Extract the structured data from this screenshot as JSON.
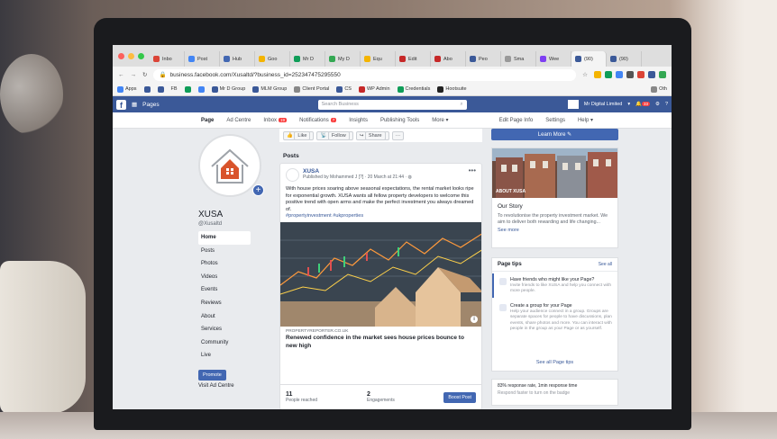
{
  "browser": {
    "tabs": [
      {
        "label": "Inbo",
        "color": "#db4437"
      },
      {
        "label": "Post",
        "color": "#4285f4"
      },
      {
        "label": "Hub",
        "color": "#4267b2"
      },
      {
        "label": "Goo",
        "color": "#f4b400"
      },
      {
        "label": "Mr D",
        "color": "#0f9d58"
      },
      {
        "label": "My D",
        "color": "#34a853"
      },
      {
        "label": "Equ",
        "color": "#f4b400"
      },
      {
        "label": "Edit",
        "color": "#c62828"
      },
      {
        "label": "Abo",
        "color": "#c62828"
      },
      {
        "label": "Peo",
        "color": "#3b5998"
      },
      {
        "label": "Sma",
        "color": "#999999"
      },
      {
        "label": "Wee",
        "color": "#7e3ff2"
      },
      {
        "label": "(90)",
        "color": "#3b5998"
      },
      {
        "label": "(90)",
        "color": "#3b5998"
      }
    ],
    "url": "business.facebook.com/Xusaltd/?business_id=252347475295550",
    "bookmarks": [
      "Apps",
      "FB",
      "Mr D Group",
      "MLM Group",
      "Client Portal",
      "CS",
      "WP Admin",
      "Credentials",
      "Hootsuite",
      "Oth"
    ]
  },
  "fb": {
    "logo": "f",
    "pages_label": "Pages",
    "search_placeholder": "Search Business",
    "account": "Mr Digital Limited",
    "notif_count": "33",
    "nav": {
      "page": "Page",
      "ad_centre": "Ad Centre",
      "inbox": "Inbox",
      "inbox_count": "19",
      "notifications": "Notifications",
      "notifications_count": "7",
      "insights": "Insights",
      "publishing_tools": "Publishing Tools",
      "more": "More",
      "edit_page_info": "Edit Page Info",
      "settings": "Settings",
      "help": "Help"
    },
    "profile": {
      "name": "XUSA",
      "handle": "@Xusaltd"
    },
    "left_nav": [
      "Home",
      "Posts",
      "Photos",
      "Videos",
      "Events",
      "Reviews",
      "About",
      "Services",
      "Community",
      "Live"
    ],
    "promote": "Promote",
    "visit_ad_centre": "Visit Ad Centre",
    "actions": {
      "like": "Like",
      "follow": "Follow",
      "share": "Share",
      "more": "···"
    },
    "posts_label": "Posts",
    "post": {
      "author": "XUSA",
      "meta": "Published by Mohammed J [?] · 20 March at 21:44 · ",
      "text": "With house prices soaring above seasonal expectations, the rental market looks ripe for exponential growth. XUSA wants all fellow property developers to welcome this positive trend with open arms and make the perfect investment you always dreamed of.",
      "tags": "#propertyinvestment #ukproperties",
      "link_source": "PROPERTYREPORTER.CO.UK",
      "link_title": "Renewed confidence in the market sees house prices bounce to new high",
      "reached": "11",
      "reached_label": "People reached",
      "engagements": "2",
      "engagements_label": "Engagements",
      "boost": "Boost Post"
    },
    "right": {
      "learn_more": "Learn More",
      "about_tag": "ABOUT XUSA",
      "story_title": "Our Story",
      "story_text": "To revolutionise the property investment market. We aim to deliver both rewarding and life changing...",
      "see_more": "See more",
      "tips_title": "Page tips",
      "see_all": "See all",
      "tip1_title": "Have friends who might like your Page?",
      "tip1_body": "Invite friends to like XUSA and help you connect with more people.",
      "tip2_title": "Create a group for your Page",
      "tip2_body": "Help your audience connect in a group. Groups are separate spaces for people to have discussions, plan events, share photos and more. You can interact with people in the group as your Page or as yourself.",
      "see_all_tips": "See all Page tips",
      "response": "83% response rate, 1min response time",
      "response_sub": "Respond faster to turn on the badge"
    }
  }
}
